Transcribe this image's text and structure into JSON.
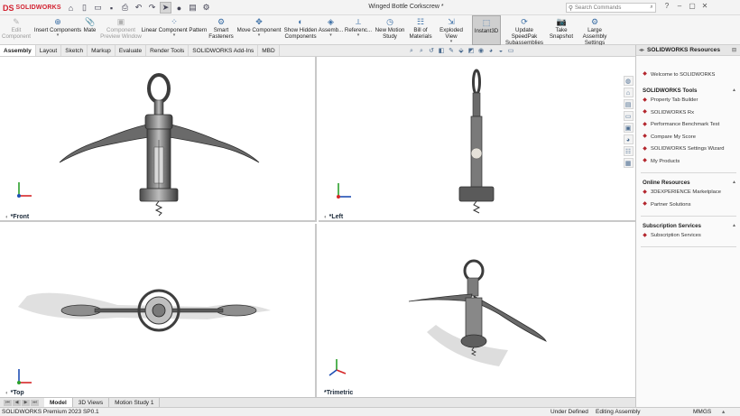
{
  "app": {
    "logo_prefix": "DS",
    "logo_text": "SOLIDWORKS",
    "title": "Winged Bottle Corkscrew *",
    "accent": "#d2202f"
  },
  "search": {
    "value": "Search Commands"
  },
  "quick_access": [
    "home-icon",
    "new-document-icon",
    "open-folder-icon",
    "save-icon",
    "print-icon",
    "undo-icon",
    "redo-icon",
    "select-arrow-icon",
    "rebuild-icon",
    "file-properties-icon",
    "options-gear-icon"
  ],
  "ribbon": [
    {
      "label": "Edit Component",
      "icon": "✎",
      "disabled": true
    },
    {
      "label": "Insert Components",
      "icon": "⊕",
      "disabled": false,
      "dropdown": true
    },
    {
      "label": "Mate",
      "icon": "📎",
      "disabled": false
    },
    {
      "label": "Component Preview Window",
      "icon": "▣",
      "disabled": true
    },
    {
      "label": "Linear Component Pattern",
      "icon": "⁘",
      "disabled": false,
      "dropdown": true
    },
    {
      "label": "Smart Fasteners",
      "icon": "⚙",
      "disabled": false
    },
    {
      "label": "Move Component",
      "icon": "✥",
      "disabled": false,
      "dropdown": true
    },
    {
      "label": "Show Hidden Components",
      "icon": "◐",
      "disabled": false
    },
    {
      "label": "Assemb...",
      "icon": "◈",
      "disabled": false,
      "dropdown": true
    },
    {
      "label": "Referenc...",
      "icon": "⟂",
      "disabled": false,
      "dropdown": true
    },
    {
      "label": "New Motion Study",
      "icon": "◷",
      "disabled": false
    },
    {
      "label": "Bill of Materials",
      "icon": "☷",
      "disabled": false
    },
    {
      "label": "Exploded View",
      "icon": "⇲",
      "disabled": false,
      "dropdown": true
    },
    {
      "label": "Instant3D",
      "icon": "⬚",
      "disabled": false,
      "active": true
    },
    {
      "label": "Update SpeedPak Subassemblies",
      "icon": "⟳",
      "disabled": false
    },
    {
      "label": "Take Snapshot",
      "icon": "📷",
      "disabled": false
    },
    {
      "label": "Large Assembly Settings",
      "icon": "⚙",
      "disabled": false
    }
  ],
  "tabs": [
    "Assembly",
    "Layout",
    "Sketch",
    "Markup",
    "Evaluate",
    "Render Tools",
    "SOLIDWORKS Add-Ins",
    "MBD"
  ],
  "active_tab": "Assembly",
  "viewports": {
    "front": "*Front",
    "left": "*Left",
    "top": "*Top",
    "trimetric": "*Trimetric"
  },
  "bottom_tabs": [
    "Model",
    "3D Views",
    "Motion Study 1"
  ],
  "status": {
    "app_version": "SOLIDWORKS Premium 2023 SP0.1",
    "state": "Under Defined",
    "mode": "Editing Assembly",
    "units": "MMGS"
  },
  "task_pane": {
    "header": "SOLIDWORKS Resources",
    "welcome": "Welcome to SOLIDWORKS",
    "sections": [
      {
        "title": "SOLIDWORKS Tools",
        "items": [
          "Property Tab Builder",
          "SOLIDWORKS Rx",
          "Performance Benchmark Test",
          "Compare My Score",
          "SOLIDWORKS Settings Wizard",
          "My Products"
        ]
      },
      {
        "title": "Online Resources",
        "items": [
          "3DEXPERIENCE Marketplace",
          "Partner Solutions"
        ]
      },
      {
        "title": "Subscription Services",
        "items": [
          "Subscription Services"
        ]
      }
    ]
  }
}
